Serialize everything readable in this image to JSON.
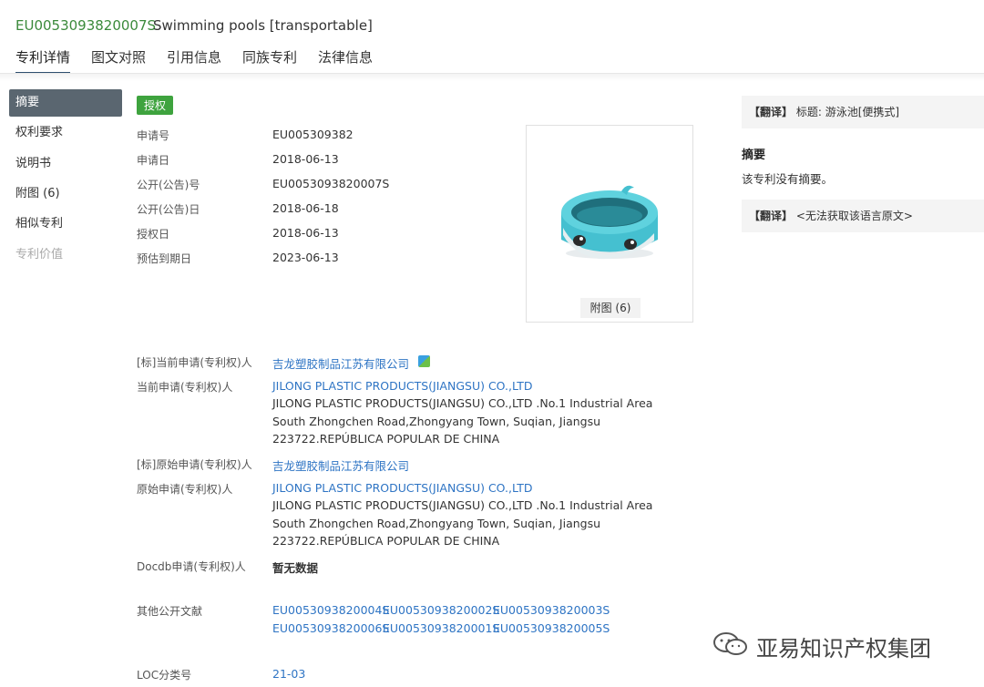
{
  "header": {
    "patent_id": "EU0053093820007S",
    "title": "Swimming pools [transportable]",
    "tabs": [
      "专利详情",
      "图文对照",
      "引用信息",
      "同族专利",
      "法律信息"
    ]
  },
  "nav": {
    "items": [
      {
        "label": "摘要"
      },
      {
        "label": "权利要求"
      },
      {
        "label": "说明书"
      },
      {
        "label": "附图 (6)"
      },
      {
        "label": "相似专利"
      },
      {
        "label": "专利价值"
      }
    ]
  },
  "status_badge": "授权",
  "fields": {
    "app_no": {
      "label": "申请号",
      "value": "EU005309382"
    },
    "app_date": {
      "label": "申请日",
      "value": "2018-06-13"
    },
    "pub_no": {
      "label": "公开(公告)号",
      "value": "EU0053093820007S"
    },
    "pub_date": {
      "label": "公开(公告)日",
      "value": "2018-06-18"
    },
    "grant_date": {
      "label": "授权日",
      "value": "2018-06-13"
    },
    "expiry_date": {
      "label": "预估到期日",
      "value": "2023-06-13"
    }
  },
  "image_card": {
    "button_label": "附图 (6)"
  },
  "applicants": {
    "std_current": {
      "label": "[标]当前申请(专利权)人",
      "value": "吉龙塑胶制品江苏有限公司"
    },
    "current": {
      "label": "当前申请(专利权)人",
      "name": "JILONG PLASTIC PRODUCTS(JIANGSU) CO.,LTD",
      "address": "JILONG PLASTIC PRODUCTS(JIANGSU) CO.,LTD .No.1 Industrial Area South Zhongchen Road,Zhongyang Town, Suqian, Jiangsu 223722.REPÚBLICA POPULAR DE CHINA"
    },
    "std_original": {
      "label": "[标]原始申请(专利权)人",
      "value": "吉龙塑胶制品江苏有限公司"
    },
    "original": {
      "label": "原始申请(专利权)人",
      "name": "JILONG PLASTIC PRODUCTS(JIANGSU) CO.,LTD",
      "address": "JILONG PLASTIC PRODUCTS(JIANGSU) CO.,LTD .No.1 Industrial Area South Zhongchen Road,Zhongyang Town, Suqian, Jiangsu 223722.REPÚBLICA POPULAR DE CHINA"
    },
    "docdb": {
      "label": "Docdb申请(专利权)人",
      "value": "暂无数据"
    }
  },
  "other_docs": {
    "label": "其他公开文献",
    "items": [
      "EU0053093820004S",
      "EU0053093820002S",
      "EU0053093820003S",
      "EU0053093820006S",
      "EU0053093820001S",
      "EU0053093820005S"
    ]
  },
  "loc": {
    "label": "LOC分类号",
    "value": "21-03"
  },
  "right_panel": {
    "translate_title": {
      "tag": "【翻译】",
      "text": "标题: 游泳池[便携式]"
    },
    "abstract_heading": "摘要",
    "abstract_text": "该专利没有摘要。",
    "translate_abstract": {
      "tag": "【翻译】",
      "text": "<无法获取该语言原文>"
    }
  },
  "watermark": "亚易知识产权集团",
  "colors": {
    "accent_green": "#3ea33e",
    "link_blue": "#2e74c4",
    "nav_active": "#5a6670"
  }
}
